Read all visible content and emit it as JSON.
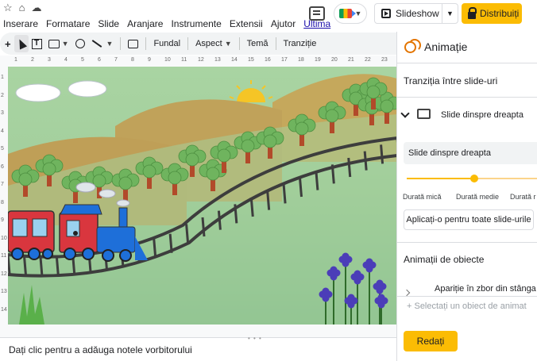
{
  "top_icons": [
    "star-icon",
    "move-to-folder-icon",
    "cloud-status-icon"
  ],
  "menu": {
    "items": [
      "Inserare",
      "Formatare",
      "Slide",
      "Aranjare",
      "Instrumente",
      "Extensii",
      "Ajutor"
    ],
    "last_edit": "Ultima"
  },
  "header": {
    "slideshow_label": "Slideshow",
    "share_label": "Distribuiți"
  },
  "toolbar": {
    "background_label": "Fundal",
    "aspect_label": "Aspect",
    "theme_label": "Temă",
    "transition_label": "Tranziție"
  },
  "ruler": {
    "horizontal": [
      "1",
      "2",
      "3",
      "4",
      "5",
      "6",
      "7",
      "8",
      "9",
      "10",
      "11",
      "12",
      "13",
      "14",
      "15",
      "16",
      "17",
      "18",
      "19",
      "20",
      "21",
      "22",
      "23"
    ],
    "vertical": [
      "1",
      "2",
      "3",
      "4",
      "5",
      "6",
      "7",
      "8",
      "9",
      "10",
      "11",
      "12",
      "13",
      "14"
    ]
  },
  "notes": {
    "placeholder": "Dați clic pentru a adăuga notele vorbitorului"
  },
  "panel": {
    "title": "Animație",
    "slide_transition_heading": "Tranziția între slide-uri",
    "transition_name": "Slide dinspre dreapta",
    "transition_select_value": "Slide dinspre dreapta",
    "duration_value_fraction": 0.5,
    "duration_labels": [
      "Durată mică",
      "Durată medie",
      "Durată r"
    ],
    "apply_all_label": "Aplicați-o pentru toate slide-urile",
    "object_animations_heading": "Animații de obiecte",
    "object_animation_name": "Apariție în zbor din stânga",
    "add_object_placeholder": "+ Selectați un obiect de animat",
    "play_label": "Redați"
  },
  "colors": {
    "accent_yellow": "#fbbc04",
    "sky_green": "#a9d4a2",
    "train_red": "#d9363e",
    "train_blue": "#1e6fd9"
  }
}
